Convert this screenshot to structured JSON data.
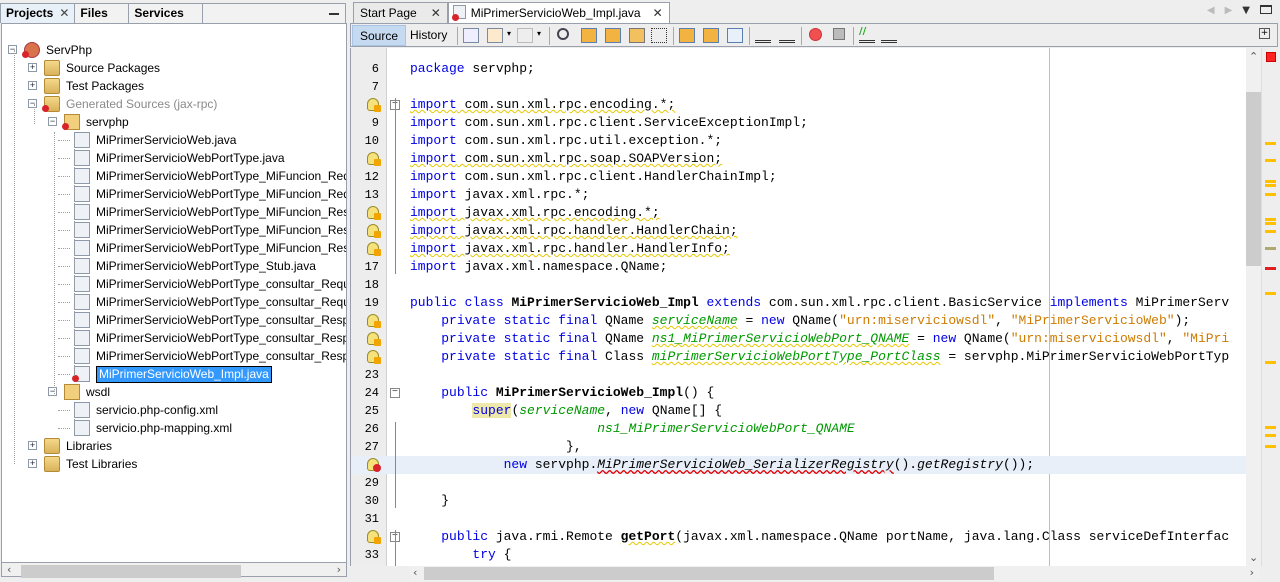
{
  "projects_panel": {
    "tabs": [
      {
        "label": "Projects",
        "active": true,
        "closable": true
      },
      {
        "label": "Files",
        "active": false
      },
      {
        "label": "Services",
        "active": false
      }
    ],
    "tree": [
      {
        "label": "ServPhp",
        "icon": "project-icon",
        "expanded": true,
        "error": true,
        "level": 0
      },
      {
        "label": "Source Packages",
        "icon": "source-folder-icon",
        "expanded": false,
        "level": 1
      },
      {
        "label": "Test Packages",
        "icon": "source-folder-icon",
        "expanded": false,
        "level": 1
      },
      {
        "label": "Generated Sources (jax-rpc)",
        "icon": "source-folder-icon",
        "expanded": true,
        "error": true,
        "dimmed": true,
        "level": 1
      },
      {
        "label": "servphp",
        "icon": "package-icon",
        "expanded": true,
        "error": true,
        "level": 2
      },
      {
        "label": "MiPrimerServicioWeb.java",
        "icon": "interface-file-icon",
        "level": 3
      },
      {
        "label": "MiPrimerServicioWebPortType.java",
        "icon": "interface-file-icon",
        "level": 3
      },
      {
        "label": "MiPrimerServicioWebPortType_MiFuncion_RequestS",
        "icon": "java-file-icon",
        "level": 3
      },
      {
        "label": "MiPrimerServicioWebPortType_MiFuncion_RequestS",
        "icon": "java-file-icon",
        "level": 3
      },
      {
        "label": "MiPrimerServicioWebPortType_MiFuncion_Respons",
        "icon": "java-file-icon",
        "level": 3
      },
      {
        "label": "MiPrimerServicioWebPortType_MiFuncion_Respons",
        "icon": "java-file-icon",
        "level": 3
      },
      {
        "label": "MiPrimerServicioWebPortType_MiFuncion_Respons",
        "icon": "java-file-icon",
        "level": 3
      },
      {
        "label": "MiPrimerServicioWebPortType_Stub.java",
        "icon": "java-file-icon",
        "level": 3
      },
      {
        "label": "MiPrimerServicioWebPortType_consultar_RequestS",
        "icon": "java-file-icon",
        "level": 3
      },
      {
        "label": "MiPrimerServicioWebPortType_consultar_RequestS",
        "icon": "java-file-icon",
        "level": 3
      },
      {
        "label": "MiPrimerServicioWebPortType_consultar_Response",
        "icon": "java-file-icon",
        "level": 3
      },
      {
        "label": "MiPrimerServicioWebPortType_consultar_Response",
        "icon": "java-file-icon",
        "level": 3
      },
      {
        "label": "MiPrimerServicioWebPortType_consultar_Response",
        "icon": "java-file-icon",
        "level": 3
      },
      {
        "label": "MiPrimerServicioWeb_Impl.java",
        "icon": "java-file-icon",
        "level": 3,
        "error": true,
        "selected": true
      },
      {
        "label": "wsdl",
        "icon": "package-icon",
        "expanded": true,
        "level": 2
      },
      {
        "label": "servicio.php-config.xml",
        "icon": "xml-file-icon",
        "level": 3
      },
      {
        "label": "servicio.php-mapping.xml",
        "icon": "xml-file-icon",
        "level": 3
      },
      {
        "label": "Libraries",
        "icon": "library-folder-icon",
        "expanded": false,
        "level": 1
      },
      {
        "label": "Test Libraries",
        "icon": "library-folder-icon",
        "expanded": false,
        "level": 1
      }
    ]
  },
  "editor": {
    "tabs": [
      {
        "label": "Start Page",
        "active": false
      },
      {
        "label": "MiPrimerServicioWeb_Impl.java",
        "active": true,
        "error": true
      }
    ],
    "view_buttons": {
      "source": "Source",
      "history": "History"
    },
    "toolbar_icons": [
      "last-edit-icon",
      "back-icon",
      "forward-icon",
      "find-icon",
      "find-previous-icon",
      "find-next-icon",
      "toggle-highlight-icon",
      "rectangular-selection-icon",
      "previous-bookmark-icon",
      "next-bookmark-icon",
      "toggle-bookmark-icon",
      "shift-left-icon",
      "shift-right-icon",
      "start-macro-icon",
      "stop-macro-icon",
      "comment-icon",
      "uncomment-icon"
    ],
    "lines": [
      {
        "n": "6",
        "marker": "",
        "html": "<span class='kw'>package</span> servphp;"
      },
      {
        "n": "7",
        "marker": "",
        "html": ""
      },
      {
        "n": "8",
        "marker": "warning",
        "fold": "minus",
        "html": "<span class='wav'><span class='kw'>import</span> com.sun.xml.rpc.encoding.*;</span>"
      },
      {
        "n": "9",
        "marker": "",
        "html": "<span class='kw'>import</span> com.sun.xml.rpc.client.ServiceExceptionImpl;"
      },
      {
        "n": "10",
        "marker": "",
        "html": "<span class='kw'>import</span> com.sun.xml.rpc.util.exception.*;"
      },
      {
        "n": "11",
        "marker": "warning",
        "html": "<span class='wav'><span class='kw'>import</span> com.sun.xml.rpc.soap.SOAPVersion;</span>"
      },
      {
        "n": "12",
        "marker": "",
        "html": "<span class='kw'>import</span> com.sun.xml.rpc.client.HandlerChainImpl;"
      },
      {
        "n": "13",
        "marker": "",
        "html": "<span class='kw'>import</span> javax.xml.rpc.*;"
      },
      {
        "n": "14",
        "marker": "warning",
        "html": "<span class='wav'><span class='kw'>import</span> javax.xml.rpc.encoding.*;</span>"
      },
      {
        "n": "15",
        "marker": "warning",
        "html": "<span class='wav'><span class='kw'>import</span> javax.xml.rpc.handler.HandlerChain;</span>"
      },
      {
        "n": "16",
        "marker": "warning",
        "html": "<span class='wav'><span class='kw'>import</span> javax.xml.rpc.handler.HandlerInfo;</span>"
      },
      {
        "n": "17",
        "marker": "",
        "fold": "end",
        "html": "<span class='kw'>import</span> javax.xml.namespace.QName;"
      },
      {
        "n": "18",
        "marker": "",
        "html": ""
      },
      {
        "n": "19",
        "marker": "",
        "html": "<span class='kw'>public class</span> <span class='b'>MiPrimerServicioWeb_Impl</span> <span class='kw'>extends</span> com.sun.xml.rpc.client.BasicService <span class='kw'>implements</span> MiPrimerServ"
      },
      {
        "n": "20",
        "marker": "warning",
        "html": "    <span class='kw'>private static final</span> QName <span class='fld wav'>serviceName</span> = <span class='kw'>new</span> QName(<span class='str'>\"urn:miserviciowsdl\"</span>, <span class='str'>\"MiPrimerServicioWeb\"</span>);"
      },
      {
        "n": "21",
        "marker": "warning",
        "html": "    <span class='kw'>private static final</span> QName <span class='fld wav'>ns1_MiPrimerServicioWebPort_QNAME</span> = <span class='kw'>new</span> QName(<span class='str'>\"urn:miserviciowsdl\"</span>, <span class='str'>\"MiPri</span>"
      },
      {
        "n": "22",
        "marker": "warning",
        "html": "    <span class='kw'>private static final</span> Class <span class='fld wav'>miPrimerServicioWebPortType_PortClass</span> = servphp.MiPrimerServicioWebPortTyp"
      },
      {
        "n": "23",
        "marker": "",
        "html": ""
      },
      {
        "n": "24",
        "marker": "",
        "fold": "minus",
        "html": "    <span class='kw'>public</span> <span class='b'>MiPrimerServicioWeb_Impl</span>() {"
      },
      {
        "n": "25",
        "marker": "",
        "html": "        <span class='kw hl'>super</span>(<span class='fld'>serviceName</span>, <span class='kw'>new</span> QName[] {"
      },
      {
        "n": "26",
        "marker": "",
        "html": "                        <span class='fld'>ns1_MiPrimerServicioWebPort_QNAME</span>"
      },
      {
        "n": "27",
        "marker": "",
        "html": "                    },"
      },
      {
        "n": "28",
        "marker": "error",
        "current": true,
        "html": "            <span class='kw'>new</span> servphp.<span class='it errw'>MiPrimerServicioWeb_SerializerRegistry</span>().<span class='it'>getRegistry</span>());"
      },
      {
        "n": "29",
        "marker": "",
        "html": ""
      },
      {
        "n": "30",
        "marker": "",
        "fold": "end",
        "html": "    }"
      },
      {
        "n": "31",
        "marker": "",
        "html": ""
      },
      {
        "n": "32",
        "marker": "warning-override",
        "fold": "minus",
        "html": "    <span class='kw'>public</span> java.rmi.Remote <span class='b wav'>getPort</span>(javax.xml.namespace.QName portName, java.lang.Class serviceDefInterfac"
      },
      {
        "n": "33",
        "marker": "",
        "html": "        <span class='kw'>try</span> {"
      }
    ],
    "error_stripe": {
      "status": "error",
      "marks": [
        {
          "type": "warning",
          "line_fraction": 0.105
        },
        {
          "type": "warning",
          "line_fraction": 0.138
        },
        {
          "type": "warning",
          "line_fraction": 0.178
        },
        {
          "type": "warning",
          "line_fraction": 0.186
        },
        {
          "type": "warning",
          "line_fraction": 0.202
        },
        {
          "type": "warning",
          "line_fraction": 0.25
        },
        {
          "type": "warning",
          "line_fraction": 0.258
        },
        {
          "type": "warning",
          "line_fraction": 0.274
        },
        {
          "type": "other",
          "line_fraction": 0.306
        },
        {
          "type": "error",
          "line_fraction": 0.346
        },
        {
          "type": "warning",
          "line_fraction": 0.394
        },
        {
          "type": "warning",
          "line_fraction": 0.527
        },
        {
          "type": "warning",
          "line_fraction": 0.652
        },
        {
          "type": "warning",
          "line_fraction": 0.667
        },
        {
          "type": "warning",
          "line_fraction": 0.69
        }
      ]
    },
    "colors": {
      "warning": "#ffc000",
      "error": "#e02020",
      "other": "#b0a870"
    }
  }
}
